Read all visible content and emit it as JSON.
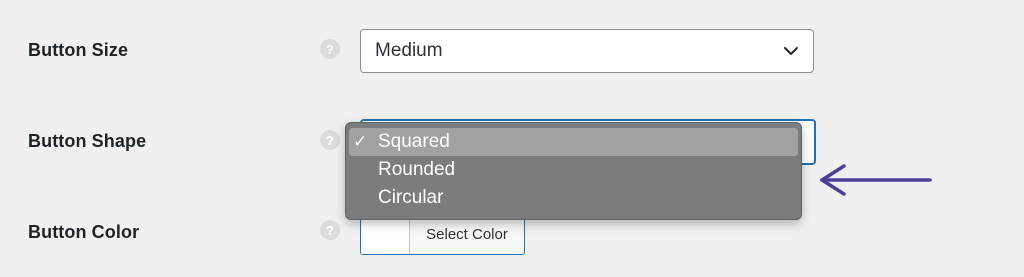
{
  "rows": {
    "size": {
      "label": "Button Size",
      "help": "?",
      "value": "Medium"
    },
    "shape": {
      "label": "Button Shape",
      "help": "?"
    },
    "color": {
      "label": "Button Color",
      "help": "?",
      "button_text": "Select Color"
    }
  },
  "shape_dropdown": {
    "check": "✓",
    "options": [
      "Squared",
      "Rounded",
      "Circular"
    ],
    "selected": "Squared"
  },
  "colors": {
    "background": "#f0f0f1",
    "focus_border": "#2271b1",
    "dropdown_bg": "#7b7c7e",
    "dropdown_selected": "#a0a1a4",
    "arrow": "#4b3f96"
  },
  "icons": {
    "help": "question-circle-icon",
    "chevron": "chevron-down-icon",
    "check": "checkmark-icon",
    "annotation": "arrow-left-icon"
  }
}
